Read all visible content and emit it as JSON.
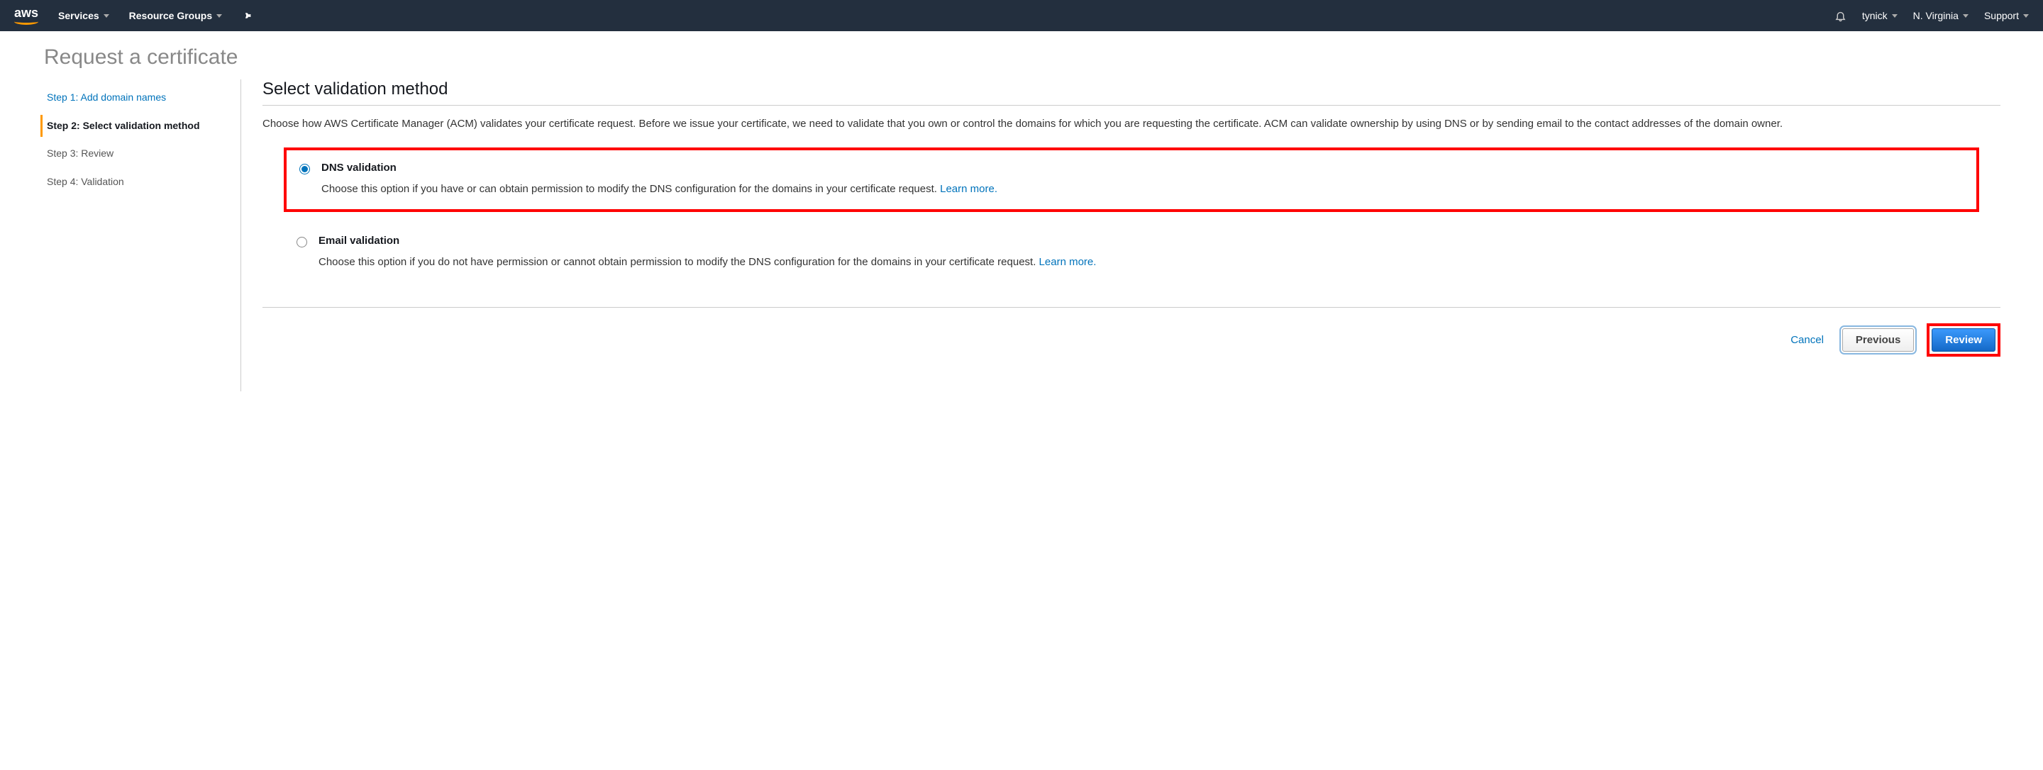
{
  "nav": {
    "logo_text": "aws",
    "services": "Services",
    "resource_groups": "Resource Groups",
    "username": "tynick",
    "region": "N. Virginia",
    "support": "Support"
  },
  "page": {
    "title": "Request a certificate"
  },
  "steps": {
    "s1": "Step 1: Add domain names",
    "s2": "Step 2: Select validation method",
    "s3": "Step 3: Review",
    "s4": "Step 4: Validation"
  },
  "main": {
    "heading": "Select validation method",
    "intro": "Choose how AWS Certificate Manager (ACM) validates your certificate request. Before we issue your certificate, we need to validate that you own or control the domains for which you are requesting the certificate. ACM can validate ownership by using DNS or by sending email to the contact addresses of the domain owner."
  },
  "options": {
    "dns_title": "DNS validation",
    "dns_desc": "Choose this option if you have or can obtain permission to modify the DNS configuration for the domains in your certificate request. ",
    "email_title": "Email validation",
    "email_desc": "Choose this option if you do not have permission or cannot obtain permission to modify the DNS configuration for the domains in your certificate request. ",
    "learn_more": "Learn more."
  },
  "footer": {
    "cancel": "Cancel",
    "previous": "Previous",
    "review": "Review"
  }
}
